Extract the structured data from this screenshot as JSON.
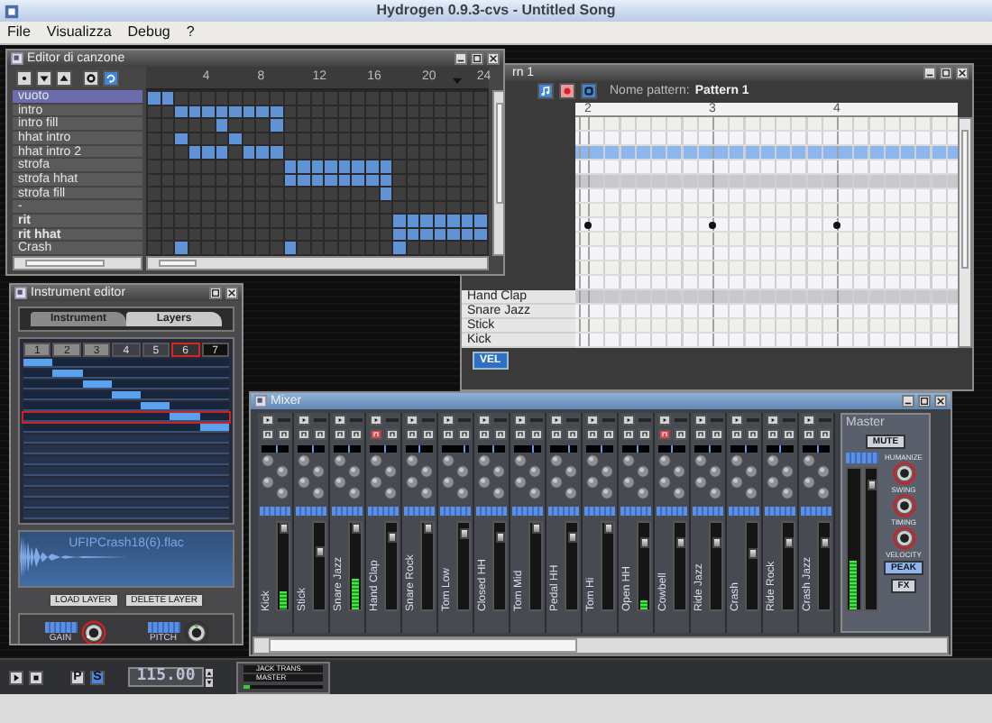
{
  "window": {
    "title": "Hydrogen 0.9.3-cvs - Untitled Song"
  },
  "menu": [
    "File",
    "Visualizza",
    "Debug",
    "?"
  ],
  "song_editor": {
    "title": "Editor di canzone",
    "ruler": [
      "4",
      "8",
      "12",
      "16",
      "20",
      "24"
    ],
    "patterns": [
      {
        "name": "vuoto",
        "selected": true,
        "bold": false,
        "cells": [
          true,
          true,
          false,
          false,
          false,
          false,
          false,
          false,
          false,
          false,
          false,
          false,
          false,
          false,
          false,
          false,
          false,
          false,
          false,
          false,
          false,
          false,
          false,
          false,
          false
        ]
      },
      {
        "name": "intro",
        "selected": false,
        "bold": false,
        "cells": [
          false,
          false,
          true,
          true,
          true,
          true,
          true,
          true,
          true,
          true,
          false,
          false,
          false,
          false,
          false,
          false,
          false,
          false,
          false,
          false,
          false,
          false,
          false,
          false,
          false
        ]
      },
      {
        "name": "intro fill",
        "selected": false,
        "bold": false,
        "cells": [
          false,
          false,
          false,
          false,
          false,
          true,
          false,
          false,
          false,
          true,
          false,
          false,
          false,
          false,
          false,
          false,
          false,
          false,
          false,
          false,
          false,
          false,
          false,
          false,
          false
        ]
      },
      {
        "name": "hhat intro",
        "selected": false,
        "bold": false,
        "cells": [
          false,
          false,
          true,
          false,
          false,
          false,
          true,
          false,
          false,
          false,
          false,
          false,
          false,
          false,
          false,
          false,
          false,
          false,
          false,
          false,
          false,
          false,
          false,
          false,
          false
        ]
      },
      {
        "name": "hhat intro 2",
        "selected": false,
        "bold": false,
        "cells": [
          false,
          false,
          false,
          true,
          true,
          true,
          false,
          true,
          true,
          true,
          false,
          false,
          false,
          false,
          false,
          false,
          false,
          false,
          false,
          false,
          false,
          false,
          false,
          false,
          false
        ]
      },
      {
        "name": "strofa",
        "selected": false,
        "bold": false,
        "cells": [
          false,
          false,
          false,
          false,
          false,
          false,
          false,
          false,
          false,
          false,
          true,
          true,
          true,
          true,
          true,
          true,
          true,
          true,
          false,
          false,
          false,
          false,
          false,
          false,
          false
        ]
      },
      {
        "name": "strofa hhat",
        "selected": false,
        "bold": false,
        "cells": [
          false,
          false,
          false,
          false,
          false,
          false,
          false,
          false,
          false,
          false,
          true,
          true,
          true,
          true,
          true,
          true,
          true,
          true,
          false,
          false,
          false,
          false,
          false,
          false,
          false
        ]
      },
      {
        "name": "strofa fill",
        "selected": false,
        "bold": false,
        "cells": [
          false,
          false,
          false,
          false,
          false,
          false,
          false,
          false,
          false,
          false,
          false,
          false,
          false,
          false,
          false,
          false,
          false,
          true,
          false,
          false,
          false,
          false,
          false,
          false,
          false
        ]
      },
      {
        "name": "-",
        "selected": false,
        "bold": false,
        "cells": [
          false,
          false,
          false,
          false,
          false,
          false,
          false,
          false,
          false,
          false,
          false,
          false,
          false,
          false,
          false,
          false,
          false,
          false,
          false,
          false,
          false,
          false,
          false,
          false,
          false
        ]
      },
      {
        "name": "rit",
        "selected": false,
        "bold": true,
        "cells": [
          false,
          false,
          false,
          false,
          false,
          false,
          false,
          false,
          false,
          false,
          false,
          false,
          false,
          false,
          false,
          false,
          false,
          false,
          true,
          true,
          true,
          true,
          true,
          true,
          true
        ]
      },
      {
        "name": "rit hhat",
        "selected": false,
        "bold": true,
        "cells": [
          false,
          false,
          false,
          false,
          false,
          false,
          false,
          false,
          false,
          false,
          false,
          false,
          false,
          false,
          false,
          false,
          false,
          false,
          true,
          true,
          true,
          true,
          true,
          true,
          true
        ]
      },
      {
        "name": "Crash",
        "selected": false,
        "bold": false,
        "cells": [
          false,
          false,
          true,
          false,
          false,
          false,
          false,
          false,
          false,
          false,
          true,
          false,
          false,
          false,
          false,
          false,
          false,
          false,
          true,
          false,
          false,
          false,
          false,
          false,
          false
        ]
      }
    ]
  },
  "pattern_editor": {
    "title": "rn 1",
    "pattern_label": "Nome pattern:",
    "pattern_name": "Pattern 1",
    "ruler": [
      "2",
      "3",
      "4"
    ],
    "rows": [
      {
        "selected": false,
        "notes": [
          false,
          false,
          false
        ]
      },
      {
        "selected": false,
        "notes": [
          false,
          false,
          false
        ]
      },
      {
        "selected": true,
        "notes": [
          false,
          false,
          false
        ]
      },
      {
        "selected": false,
        "notes": [
          false,
          false,
          false
        ]
      },
      {
        "selected": false,
        "notes": [
          false,
          false,
          false
        ]
      },
      {
        "selected": false,
        "notes": [
          false,
          false,
          false
        ]
      },
      {
        "selected": false,
        "notes": [
          false,
          false,
          false
        ]
      },
      {
        "selected": false,
        "notes": [
          true,
          true,
          true
        ]
      },
      {
        "selected": false,
        "notes": [
          false,
          false,
          false
        ]
      },
      {
        "selected": false,
        "notes": [
          false,
          false,
          false
        ]
      },
      {
        "selected": false,
        "notes": [
          false,
          false,
          false
        ]
      },
      {
        "selected": false,
        "notes": [
          false,
          false,
          false
        ]
      },
      {
        "name": "Hand Clap",
        "selected": false,
        "notes": [
          false,
          false,
          false
        ]
      },
      {
        "name": "Snare Jazz",
        "selected": false,
        "notes": [
          false,
          false,
          false
        ]
      },
      {
        "name": "Stick",
        "selected": false,
        "notes": [
          false,
          false,
          false
        ]
      },
      {
        "name": "Kick",
        "selected": false,
        "notes": [
          false,
          false,
          false
        ]
      }
    ],
    "velocity_button": "VEL"
  },
  "instrument_editor": {
    "title": "Instrument editor",
    "tabs": [
      {
        "label": "Instrument",
        "selected": false
      },
      {
        "label": "Layers",
        "selected": true
      }
    ],
    "layers": [
      {
        "number": "1",
        "selected": false
      },
      {
        "number": "2",
        "selected": false
      },
      {
        "number": "3",
        "selected": false
      },
      {
        "number": "4",
        "selected": false
      },
      {
        "number": "5",
        "selected": false
      },
      {
        "number": "6",
        "selected": true
      },
      {
        "number": "7",
        "selected": false
      }
    ],
    "sample": "UFIPCrash18(6).flac",
    "buttons": [
      "LOAD LAYER",
      "DELETE LAYER"
    ],
    "knobs": [
      "GAIN",
      "PITCH"
    ]
  },
  "mixer": {
    "title": "Mixer",
    "channels": [
      {
        "name": "Kick",
        "muted": false,
        "pan": {
          "level": 0.55
        },
        "fader": {
          "level": 1
        },
        "meter": {
          "level": 0.2
        }
      },
      {
        "name": "Stick",
        "muted": false,
        "pan": {
          "level": 0.5
        },
        "fader": {
          "level": 0.7
        },
        "meter": {
          "level": 0
        }
      },
      {
        "name": "Snare Jazz",
        "muted": false,
        "pan": {
          "level": 0.5
        },
        "fader": {
          "level": 1
        },
        "meter": {
          "level": 0.35
        }
      },
      {
        "name": "Hand Clap",
        "muted": true,
        "pan": {
          "level": 0.5
        },
        "fader": {
          "level": 0.87
        },
        "meter": {
          "level": 0
        }
      },
      {
        "name": "Snare Rock",
        "muted": false,
        "pan": {
          "level": 0.48
        },
        "fader": {
          "level": 1
        },
        "meter": {
          "level": 0
        }
      },
      {
        "name": "Tom Low",
        "muted": false,
        "pan": {
          "level": 0.8
        },
        "fader": {
          "level": 0.93
        },
        "meter": {
          "level": 0
        }
      },
      {
        "name": "Closed HH",
        "muted": false,
        "pan": {
          "level": 0.5
        },
        "fader": {
          "level": 0.87
        },
        "meter": {
          "level": 0
        }
      },
      {
        "name": "Tom Mid",
        "muted": false,
        "pan": {
          "level": 0.65
        },
        "fader": {
          "level": 1
        },
        "meter": {
          "level": 0
        }
      },
      {
        "name": "Pedal HH",
        "muted": false,
        "pan": {
          "level": 0.65
        },
        "fader": {
          "level": 0.87
        },
        "meter": {
          "level": 0
        }
      },
      {
        "name": "Tom Hi",
        "muted": false,
        "pan": {
          "level": 0.5
        },
        "fader": {
          "level": 1
        },
        "meter": {
          "level": 0
        }
      },
      {
        "name": "Open HH",
        "muted": false,
        "pan": {
          "level": 0.5
        },
        "fader": {
          "level": 0.8
        },
        "meter": {
          "level": 0.1
        }
      },
      {
        "name": "Cowbell",
        "muted": true,
        "pan": {
          "level": 0.48
        },
        "fader": {
          "level": 0.8
        },
        "meter": {
          "level": 0
        }
      },
      {
        "name": "Ride Jazz",
        "muted": false,
        "pan": {
          "level": 0.5
        },
        "fader": {
          "level": 0.8
        },
        "meter": {
          "level": 0
        }
      },
      {
        "name": "Crash",
        "muted": false,
        "pan": {
          "level": 0.5
        },
        "fader": {
          "level": 0.67
        },
        "meter": {
          "level": 0
        }
      },
      {
        "name": "Ride Rock",
        "muted": false,
        "pan": {
          "level": 0.46
        },
        "fader": {
          "level": 0.8
        },
        "meter": {
          "level": 0
        }
      },
      {
        "name": "Crash Jazz",
        "muted": false,
        "pan": {
          "level": 0.5
        },
        "fader": {
          "level": 0.8
        },
        "meter": {
          "level": 0
        }
      }
    ],
    "master": {
      "title": "Master",
      "mute": "MUTE",
      "fader": {
        "level": 0.92
      },
      "meter": {
        "level": 0.35
      },
      "humanize": "HUMANIZE",
      "knobs": [
        "SWING",
        "TIMING",
        "VELOCITY"
      ],
      "buttons": [
        "PEAK",
        "FX"
      ]
    }
  },
  "transport": {
    "pattern_mode": "P",
    "song_mode": "S",
    "bpm": "115.00",
    "jack_transport": "JACK TRANS.",
    "jack_master": "MASTER"
  }
}
